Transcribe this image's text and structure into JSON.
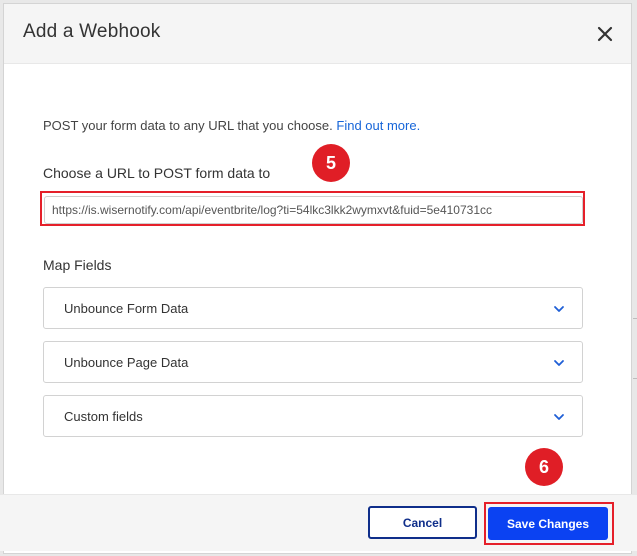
{
  "dialog": {
    "title": "Add a Webhook",
    "close_icon": "close-icon"
  },
  "intro": {
    "text": "POST your form data to any URL that you choose.",
    "link_text": "Find out more."
  },
  "url_section": {
    "label": "Choose a URL to POST form data to",
    "value": "https://is.wisernotify.com/api/eventbrite/log?ti=54lkc3lkk2wymxvt&fuid=5e410731cc"
  },
  "map_fields": {
    "label": "Map Fields",
    "items": [
      {
        "label": "Unbounce Form Data",
        "icon": "chevron-down-icon"
      },
      {
        "label": "Unbounce Page Data",
        "icon": "chevron-down-icon"
      },
      {
        "label": "Custom fields",
        "icon": "chevron-down-icon"
      }
    ]
  },
  "footer": {
    "cancel_label": "Cancel",
    "save_label": "Save Changes"
  },
  "annotations": {
    "step_url": "5",
    "step_save": "6"
  },
  "colors": {
    "accent_blue": "#0b42f2",
    "cancel_border": "#0f2e8a",
    "link": "#1665d8",
    "annotation_red": "#e01e26"
  }
}
